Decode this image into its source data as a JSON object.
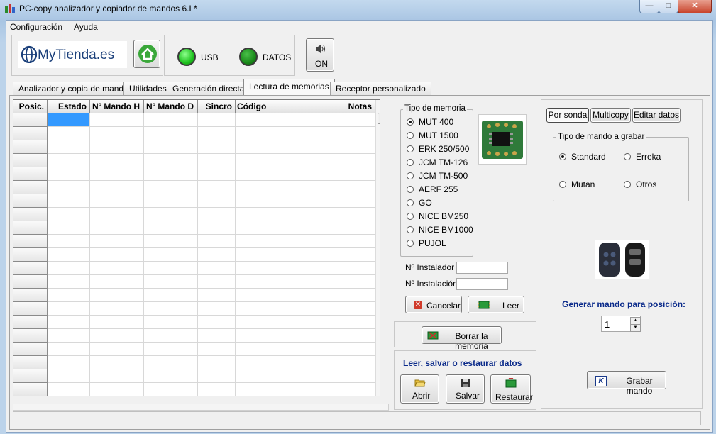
{
  "window": {
    "title": "PC-copy analizador y copiador de mandos 6.L*",
    "minimize": "—",
    "maximize": "□",
    "close": "✕"
  },
  "menu": [
    "Configuración",
    "Ayuda"
  ],
  "brand": {
    "logo_text": "MyTienda.es"
  },
  "status": {
    "usb_label": "USB",
    "datos_label": "DATOS",
    "sound_label": "ON",
    "led_color": "#1fc21f"
  },
  "tabs": [
    "Analizador y copia de mandos",
    "Utilidades",
    "Generación directa",
    "Lectura de memorias",
    "Receptor personalizado"
  ],
  "active_tab": "Lectura de memorias",
  "grid": {
    "columns": [
      "Posic.",
      "Estado",
      "Nº Mando H",
      "Nº Mando D",
      "Sincro",
      "Código",
      "Notas"
    ],
    "row_count": 21
  },
  "memory": {
    "legend": "Tipo de memoria",
    "options": [
      "MUT 400",
      "MUT 1500",
      "ERK 250/500",
      "JCM TM-126",
      "JCM TM-500",
      "AERF 255",
      "GO",
      "NICE BM250",
      "NICE BM1000",
      "PUJOL"
    ],
    "selected": "MUT 400",
    "installer_label": "Nº Instalador",
    "installer_value": "",
    "installation_label": "Nº Instalación",
    "installation_value": "",
    "cancel_label": "Cancelar",
    "read_label": "Leer",
    "erase_label": "Borrar la memoria"
  },
  "data_section": {
    "title": "Leer, salvar o restaurar datos",
    "open_label": "Abrir",
    "save_label": "Salvar",
    "restore_label": "Restaurar"
  },
  "right_panel": {
    "subtabs": [
      "Por sonda",
      "Multicopy",
      "Editar datos"
    ],
    "active_subtab": "Por sonda",
    "mode_legend": "Tipo de mando a grabar",
    "modes": [
      "Standard",
      "Erreka",
      "Mutan",
      "Otros"
    ],
    "selected_mode": "Standard",
    "generate_label": "Generar mando para posición:",
    "position_value": "1",
    "record_label": "Grabar mando"
  }
}
